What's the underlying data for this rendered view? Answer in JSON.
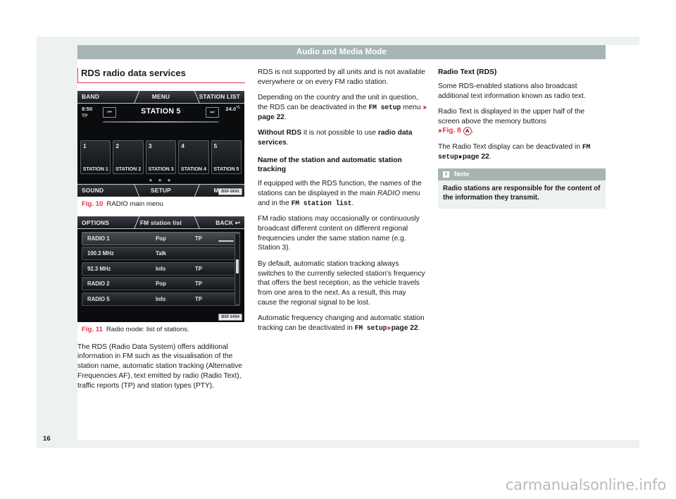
{
  "header": {
    "title": "Audio and Media Mode"
  },
  "page": {
    "number": "16"
  },
  "watermark": {
    "text": "carmanualsonline.info"
  },
  "col1": {
    "heading": "RDS radio data services",
    "fig10": {
      "num": "Fig. 10",
      "caption": "RADIO main menu",
      "id": "B5F-0691",
      "topbar": {
        "left": "BAND",
        "center": "MENU",
        "right": "STATION LIST"
      },
      "botbar": {
        "left": "SOUND",
        "center": "SETUP",
        "right": "MANUAL"
      },
      "time": "9:50",
      "tp": "TP",
      "temp": "24.0",
      "temp_unit": "°C",
      "station": "STATION 5",
      "prev_icon": "⏮",
      "next_icon": "⏭",
      "dots": "● ● ●",
      "presets": [
        {
          "num": "1",
          "name": "STATION 1"
        },
        {
          "num": "2",
          "name": "STATION 2"
        },
        {
          "num": "3",
          "name": "STATION 3"
        },
        {
          "num": "4",
          "name": "STATION 4"
        },
        {
          "num": "5",
          "name": "STATION 5"
        }
      ]
    },
    "fig11": {
      "num": "Fig. 11",
      "caption": "Radio mode: list of stations.",
      "id": "B5F-0494",
      "topbar": {
        "left": "OPTIONS",
        "center": "FM station list",
        "right": "BACK"
      },
      "back_icon": "↩",
      "rows": [
        {
          "name": "RADIO 1",
          "genre": "Pop",
          "tp": "TP",
          "selected": true
        },
        {
          "name": "100.3 MHz",
          "genre": "Talk",
          "tp": "",
          "selected": false
        },
        {
          "name": "92.3 MHz",
          "genre": "Info",
          "tp": "TP",
          "selected": false
        },
        {
          "name": "RADIO 2",
          "genre": "Pop",
          "tp": "TP",
          "selected": false
        },
        {
          "name": "RADIO 5",
          "genre": "Info",
          "tp": "TP",
          "selected": false
        }
      ]
    },
    "para1": "The RDS (Radio Data System) offers additional information in FM such as the visualisation of the station name, automatic station tracking (Alternative Frequencies AF), text emitted by radio (Radio Text), traffic reports (TP) and station types (PTY)."
  },
  "col2": {
    "para1": "RDS is not supported by all units and is not available everywhere or on every FM radio station.",
    "para2_a": "Depending on the country and the unit in question, the RDS can be deactivated in the ",
    "para2_mono": "FM setup",
    "para2_b": " menu ",
    "para2_arrows": "›››",
    "para2_ref": "page 22",
    "para2_c": ".",
    "para3_a": "Without RDS",
    "para3_b": " it is not possible to use ",
    "para3_c": "radio data services",
    "para3_d": ".",
    "heading1": "Name of the station and automatic station tracking",
    "para4_a": "If equipped with the RDS function, the names of the stations can be displayed in the main ",
    "para4_italic": "RADIO",
    "para4_b": " menu and in the ",
    "para4_mono": "FM station list",
    "para4_c": ".",
    "para5": "FM radio stations may occasionally or continuously broadcast different content on different regional frequencies under the same station name (e.g. Station 3).",
    "para6": "By default, automatic station tracking always switches to the currently selected station's frequency that offers the best reception, as the vehicle travels from one area to the next. As a result, this may cause the regional signal to be lost.",
    "para7_a": "Automatic frequency changing and automatic station tracking can be deactivated in ",
    "para7_mono": "FM setup",
    "para7_arrows": "›››",
    "para7_ref": "page 22",
    "para7_b": "."
  },
  "col3": {
    "heading1": "Radio Text (RDS)",
    "para1": "Some RDS-enabled stations also broadcast additional text information known as radio text.",
    "para2_a": "Radio Text is displayed in the upper half of the screen above the memory buttons",
    "para2_arrows": "›››",
    "para2_ref": "Fig. 8",
    "para2_badge": "A",
    "para2_b": ".",
    "para3_a": "The Radio Text display can be deactivated in ",
    "para3_mono": "FM setup",
    "para3_arrows": "›››",
    "para3_ref": "page 22",
    "para3_b": ".",
    "note": {
      "icon": "i",
      "title": "Note",
      "body": "Radio stations are responsible for the content of the information they transmit."
    }
  },
  "colors": {
    "accent_red": "#e8344a",
    "header_gray": "#a7b4b4",
    "page_bg": "#eef1f1"
  }
}
